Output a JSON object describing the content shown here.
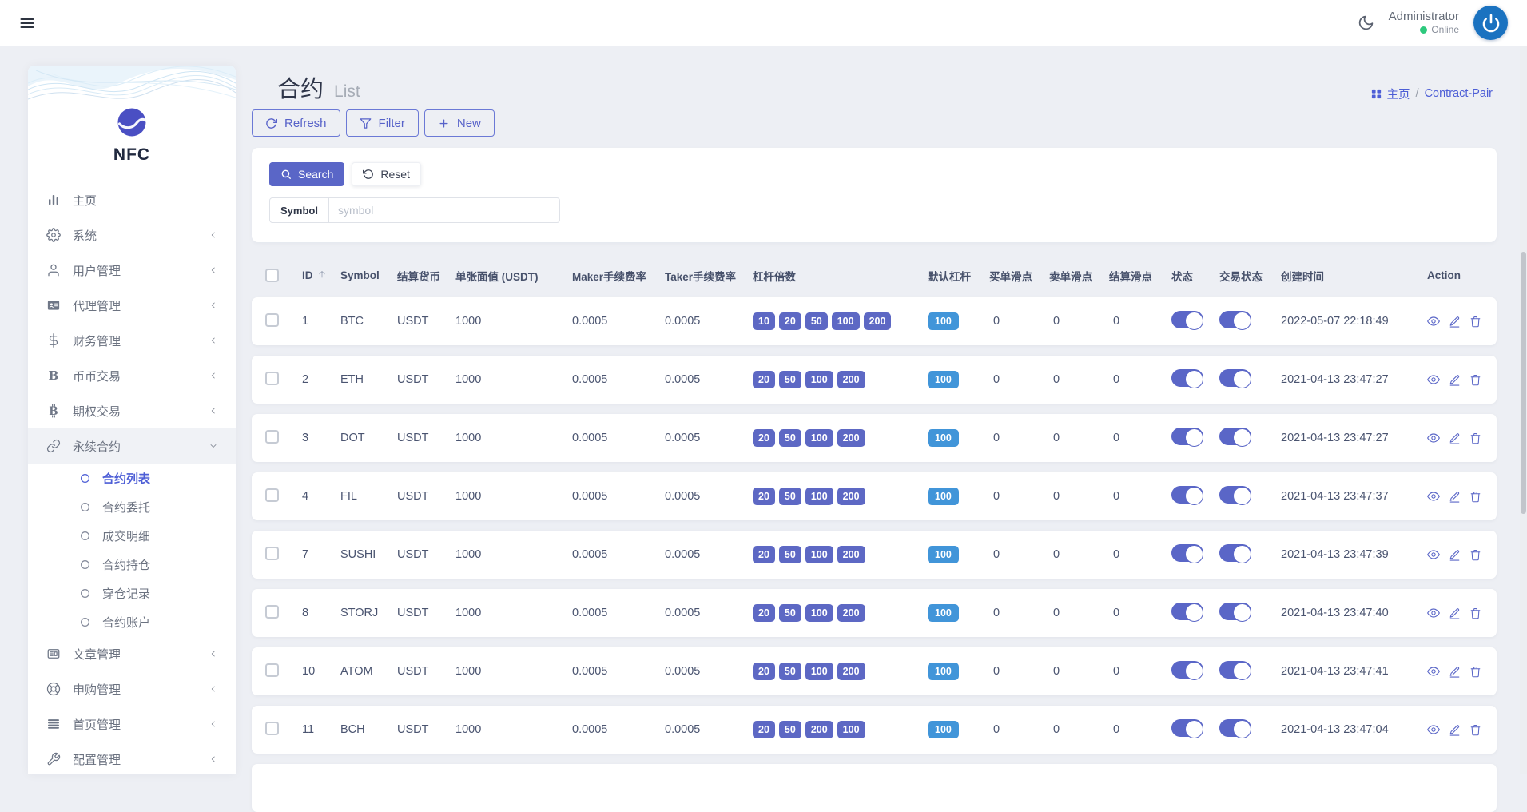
{
  "topbar": {
    "user_name": "Administrator",
    "user_status": "Online"
  },
  "sidebar": {
    "logo_text": "NFC",
    "items": [
      {
        "label": "主页",
        "icon": "chart-bars"
      },
      {
        "label": "系统",
        "icon": "gear",
        "chevron": "left"
      },
      {
        "label": "用户管理",
        "icon": "user",
        "chevron": "left"
      },
      {
        "label": "代理管理",
        "icon": "id-card",
        "chevron": "left"
      },
      {
        "label": "财务管理",
        "icon": "dollar",
        "chevron": "left"
      },
      {
        "label": "币币交易",
        "icon": "letter-b",
        "chevron": "left"
      },
      {
        "label": "期权交易",
        "icon": "bitcoin",
        "chevron": "left"
      },
      {
        "label": "永续合约",
        "icon": "chain-link",
        "chevron": "down",
        "expanded": true,
        "children": [
          {
            "label": "合约列表",
            "active": true
          },
          {
            "label": "合约委托"
          },
          {
            "label": "成交明细"
          },
          {
            "label": "合约持仓"
          },
          {
            "label": "穿仓记录"
          },
          {
            "label": "合约账户"
          }
        ]
      },
      {
        "label": "文章管理",
        "icon": "newspaper",
        "chevron": "left"
      },
      {
        "label": "申购管理",
        "icon": "life-ring",
        "chevron": "left"
      },
      {
        "label": "首页管理",
        "icon": "list-lines",
        "chevron": "left"
      },
      {
        "label": "配置管理",
        "icon": "wrench",
        "chevron": "left"
      }
    ]
  },
  "page": {
    "title": "合约",
    "subtitle": "List",
    "breadcrumb_home": "主页",
    "breadcrumb_sep": "/",
    "breadcrumb_current": "Contract-Pair"
  },
  "toolbar": {
    "refresh_label": "Refresh",
    "filter_label": "Filter",
    "new_label": "New"
  },
  "search_panel": {
    "search_label": "Search",
    "reset_label": "Reset",
    "symbol_label": "Symbol",
    "symbol_placeholder": "symbol",
    "symbol_value": ""
  },
  "table": {
    "sort": {
      "column": "ID",
      "direction": "asc"
    },
    "headers": [
      "ID",
      "Symbol",
      "结算货币",
      "单张面值 (USDT)",
      "Maker手续费率",
      "Taker手续费率",
      "杠杆倍数",
      "默认杠杆",
      "买单滑点",
      "卖单滑点",
      "结算滑点",
      "状态",
      "交易状态",
      "创建时间",
      "Action"
    ],
    "rows": [
      {
        "id": "1",
        "symbol": "BTC",
        "settle_currency": "USDT",
        "face_value": "1000",
        "maker_fee": "0.0005",
        "taker_fee": "0.0005",
        "leverages": [
          "10",
          "20",
          "50",
          "100",
          "200"
        ],
        "default_leverage": "100",
        "buy_slippage": "0",
        "sell_slippage": "0",
        "settle_slippage": "0",
        "status_on": true,
        "trade_status_on": true,
        "created_at": "2022-05-07 22:18:49"
      },
      {
        "id": "2",
        "symbol": "ETH",
        "settle_currency": "USDT",
        "face_value": "1000",
        "maker_fee": "0.0005",
        "taker_fee": "0.0005",
        "leverages": [
          "20",
          "50",
          "100",
          "200"
        ],
        "default_leverage": "100",
        "buy_slippage": "0",
        "sell_slippage": "0",
        "settle_slippage": "0",
        "status_on": true,
        "trade_status_on": true,
        "created_at": "2021-04-13 23:47:27"
      },
      {
        "id": "3",
        "symbol": "DOT",
        "settle_currency": "USDT",
        "face_value": "1000",
        "maker_fee": "0.0005",
        "taker_fee": "0.0005",
        "leverages": [
          "20",
          "50",
          "100",
          "200"
        ],
        "default_leverage": "100",
        "buy_slippage": "0",
        "sell_slippage": "0",
        "settle_slippage": "0",
        "status_on": true,
        "trade_status_on": true,
        "created_at": "2021-04-13 23:47:27"
      },
      {
        "id": "4",
        "symbol": "FIL",
        "settle_currency": "USDT",
        "face_value": "1000",
        "maker_fee": "0.0005",
        "taker_fee": "0.0005",
        "leverages": [
          "20",
          "50",
          "100",
          "200"
        ],
        "default_leverage": "100",
        "buy_slippage": "0",
        "sell_slippage": "0",
        "settle_slippage": "0",
        "status_on": true,
        "trade_status_on": true,
        "created_at": "2021-04-13 23:47:37"
      },
      {
        "id": "7",
        "symbol": "SUSHI",
        "settle_currency": "USDT",
        "face_value": "1000",
        "maker_fee": "0.0005",
        "taker_fee": "0.0005",
        "leverages": [
          "20",
          "50",
          "100",
          "200"
        ],
        "default_leverage": "100",
        "buy_slippage": "0",
        "sell_slippage": "0",
        "settle_slippage": "0",
        "status_on": true,
        "trade_status_on": true,
        "created_at": "2021-04-13 23:47:39"
      },
      {
        "id": "8",
        "symbol": "STORJ",
        "settle_currency": "USDT",
        "face_value": "1000",
        "maker_fee": "0.0005",
        "taker_fee": "0.0005",
        "leverages": [
          "20",
          "50",
          "100",
          "200"
        ],
        "default_leverage": "100",
        "buy_slippage": "0",
        "sell_slippage": "0",
        "settle_slippage": "0",
        "status_on": true,
        "trade_status_on": true,
        "created_at": "2021-04-13 23:47:40"
      },
      {
        "id": "10",
        "symbol": "ATOM",
        "settle_currency": "USDT",
        "face_value": "1000",
        "maker_fee": "0.0005",
        "taker_fee": "0.0005",
        "leverages": [
          "20",
          "50",
          "100",
          "200"
        ],
        "default_leverage": "100",
        "buy_slippage": "0",
        "sell_slippage": "0",
        "settle_slippage": "0",
        "status_on": true,
        "trade_status_on": true,
        "created_at": "2021-04-13 23:47:41"
      },
      {
        "id": "11",
        "symbol": "BCH",
        "settle_currency": "USDT",
        "face_value": "1000",
        "maker_fee": "0.0005",
        "taker_fee": "0.0005",
        "leverages": [
          "20",
          "50",
          "200",
          "100"
        ],
        "default_leverage": "100",
        "buy_slippage": "0",
        "sell_slippage": "0",
        "settle_slippage": "0",
        "status_on": true,
        "trade_status_on": true,
        "created_at": "2021-04-13 23:47:04"
      }
    ]
  },
  "colors": {
    "accent_indigo": "#5a66c7",
    "leverage_badge": "#5d68c4",
    "default_leverage_badge": "#4195d9",
    "online_green": "#2dc97d",
    "avatar_blue": "#1a72c0",
    "page_bg": "#edeff4"
  }
}
